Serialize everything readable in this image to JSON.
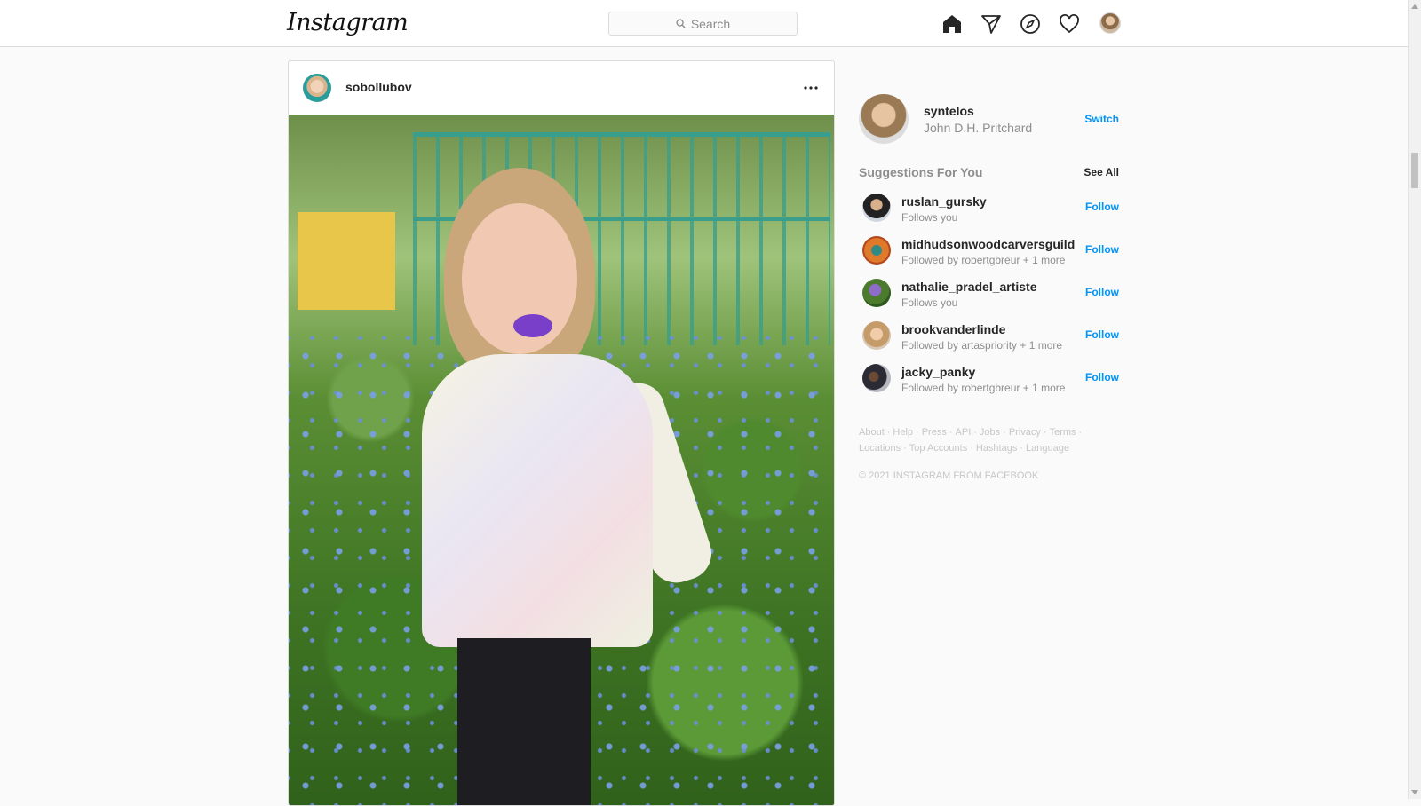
{
  "header": {
    "logo_text": "Instagram",
    "search_placeholder": "Search",
    "icons": [
      "home-icon",
      "direct-messages-icon",
      "explore-icon",
      "activity-heart-icon",
      "profile-avatar"
    ]
  },
  "post": {
    "username": "sobollubov",
    "more_icon": "ellipsis-icon"
  },
  "sidebar": {
    "profile": {
      "username": "syntelos",
      "full_name": "John D.H. Pritchard",
      "switch_label": "Switch"
    },
    "suggestions_title": "Suggestions For You",
    "see_all_label": "See All",
    "suggestions": [
      {
        "username": "ruslan_gursky",
        "subtitle": "Follows you",
        "action": "Follow"
      },
      {
        "username": "midhudsonwoodcarversguild",
        "subtitle": "Followed by robertgbreur + 1 more",
        "action": "Follow"
      },
      {
        "username": "nathalie_pradel_artiste",
        "subtitle": "Follows you",
        "action": "Follow"
      },
      {
        "username": "brookvanderlinde",
        "subtitle": "Followed by artaspriority + 1 more",
        "action": "Follow"
      },
      {
        "username": "jacky_panky",
        "subtitle": "Followed by robertgbreur + 1 more",
        "action": "Follow"
      }
    ],
    "footer_links_row1": [
      "About",
      "Help",
      "Press",
      "API",
      "Jobs",
      "Privacy",
      "Terms"
    ],
    "footer_links_row2": [
      "Locations",
      "Top Accounts",
      "Hashtags",
      "Language"
    ],
    "copyright": "© 2021 INSTAGRAM FROM FACEBOOK"
  },
  "colors": {
    "accent_blue": "#0095f6",
    "text_primary": "#262626",
    "text_secondary": "#8e8e8e",
    "border": "#dbdbdb"
  }
}
